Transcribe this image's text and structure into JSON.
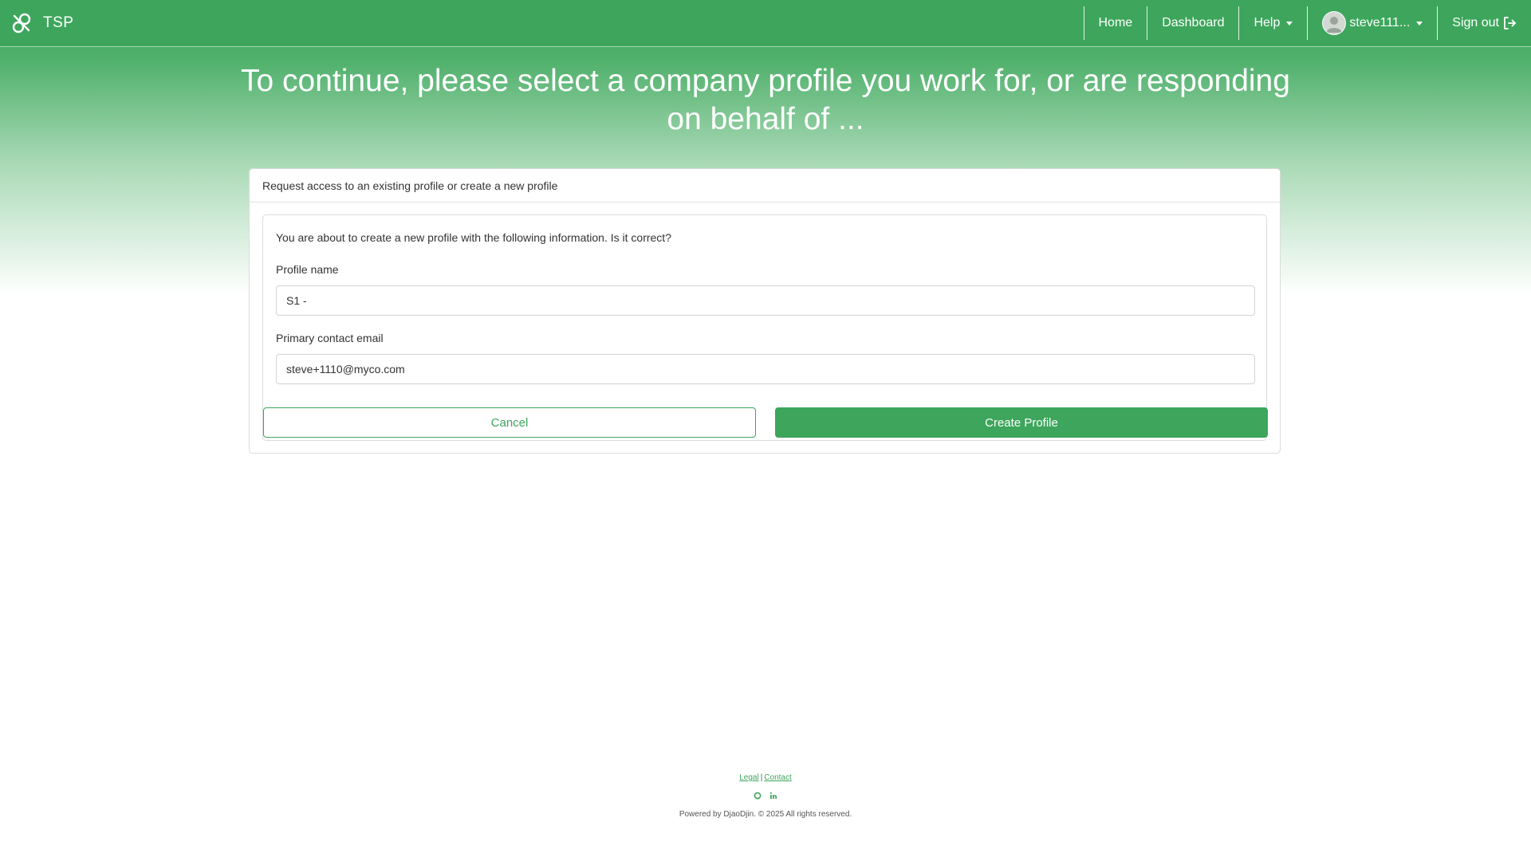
{
  "app": {
    "name": "TSP"
  },
  "nav": {
    "home": "Home",
    "dashboard": "Dashboard",
    "help": "Help",
    "user": "steve111...",
    "signout": "Sign out"
  },
  "page": {
    "title": "To continue, please select a company profile you work for, or are responding on behalf of ..."
  },
  "card": {
    "header": "Request access to an existing profile or create a new profile",
    "intro": "You are about to create a new profile with the following information. Is it correct?",
    "profile_name_label": "Profile name",
    "profile_name_value": "S1 -",
    "email_label": "Primary contact email",
    "email_value": "steve+1110@myco.com",
    "cancel_label": "Cancel",
    "create_label": "Create Profile"
  },
  "footer": {
    "legal": "Legal",
    "separator": "|",
    "contact": "Contact",
    "copyright": "Powered by DjaoDjin. © 2025 All rights reserved.",
    "icons": [
      "github-icon",
      "linkedin-icon"
    ]
  },
  "colors": {
    "brand": "#3da65c"
  }
}
